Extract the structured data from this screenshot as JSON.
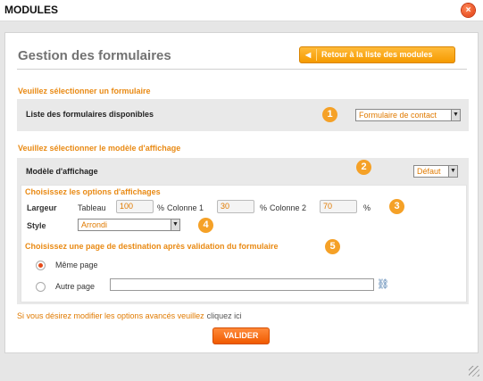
{
  "window": {
    "title": "MODULES",
    "close_glyph": "×"
  },
  "page": {
    "heading": "Gestion des formulaires",
    "back_button_label": "Retour à la liste des modules",
    "back_button_icon": "arrow-left-icon"
  },
  "form_section": {
    "label": "Veuillez sélectionner un formulaire",
    "list_label": "Liste des formulaires disponibles",
    "badge": "1",
    "selected": "Formulaire de contact"
  },
  "display_section": {
    "label": "Veuillez sélectionner le modèle d'affichage",
    "model_label": "Modèle d'affichage",
    "badge": "2",
    "selected": "Défaut"
  },
  "options": {
    "title": "Choisissez les options d'affichages",
    "width_label": "Largeur",
    "table_label": "Tableau",
    "table_value": "100",
    "col1_label": "Colonne 1",
    "col1_value": "30",
    "col2_label": "Colonne 2",
    "col2_value": "70",
    "percent": "%",
    "badge": "3",
    "style_label": "Style",
    "style_selected": "Arrondi",
    "style_badge": "4"
  },
  "destination": {
    "title": "Choisissez une page de destination après validation du formulaire",
    "badge": "5",
    "same_page_label": "Même page",
    "same_page_selected": true,
    "other_page_label": "Autre page",
    "other_page_value": "",
    "link_icon": "link-icon"
  },
  "footer": {
    "advanced_text": "Si vous désirez modifier les options avancés veuillez",
    "advanced_link": "cliquez ici",
    "submit_label": "VALIDER"
  },
  "colors": {
    "accent_orange": "#e98a14",
    "button_orange": "#f59a00",
    "submit_orange": "#f05a00",
    "close_red": "#e0380c"
  }
}
